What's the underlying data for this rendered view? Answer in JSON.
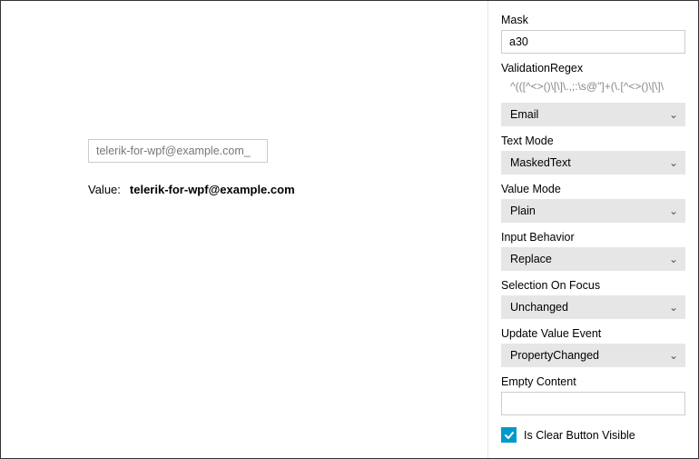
{
  "main": {
    "input_value": "telerik-for-wpf@example.com_",
    "value_label": "Value:",
    "value_text": "telerik-for-wpf@example.com"
  },
  "fields": {
    "mask": {
      "label": "Mask",
      "value": "a30"
    },
    "validation_regex": {
      "label": "ValidationRegex",
      "value": "^(([^<>()\\[\\]\\.,;:\\s@\"]+(\\.[^<>()\\[\\]\\"
    },
    "regex_preset": {
      "value": "Email"
    },
    "text_mode": {
      "label": "Text Mode",
      "value": "MaskedText"
    },
    "value_mode": {
      "label": "Value Mode",
      "value": "Plain"
    },
    "input_behavior": {
      "label": "Input Behavior",
      "value": "Replace"
    },
    "selection_on_focus": {
      "label": "Selection On Focus",
      "value": "Unchanged"
    },
    "update_value_event": {
      "label": "Update Value Event",
      "value": "PropertyChanged"
    },
    "empty_content": {
      "label": "Empty Content",
      "value": ""
    },
    "clear_button": {
      "label": "Is Clear Button Visible",
      "checked": true
    }
  }
}
